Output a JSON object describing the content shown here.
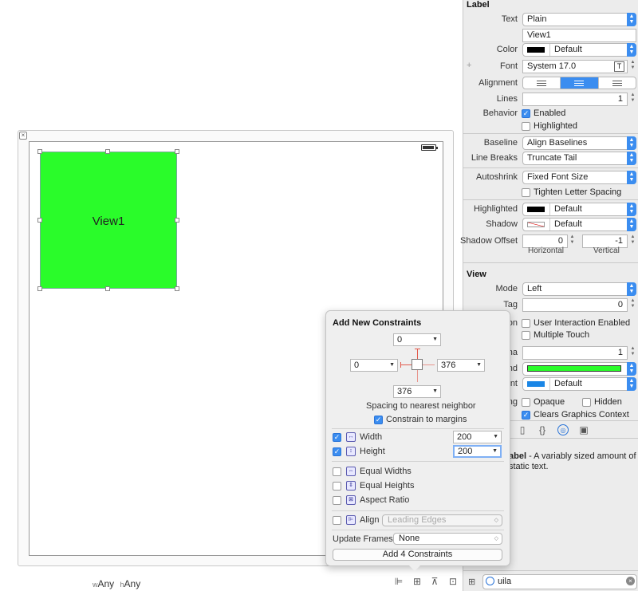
{
  "canvas": {
    "view_label": "View1",
    "size_class": {
      "w_prefix": "w",
      "w_value": "Any",
      "h_prefix": "h",
      "h_value": "Any"
    }
  },
  "inspector": {
    "label_section": {
      "title": "Label",
      "text_label": "Text",
      "text_value": "Plain",
      "text_field": "View1",
      "color_label": "Color",
      "color_value": "Default",
      "font_label": "Font",
      "font_value": "System 17.0",
      "alignment_label": "Alignment",
      "lines_label": "Lines",
      "lines_value": "1",
      "behavior_label": "Behavior",
      "enabled_label": "Enabled",
      "highlighted_check_label": "Highlighted",
      "baseline_label": "Baseline",
      "baseline_value": "Align Baselines",
      "line_breaks_label": "Line Breaks",
      "line_breaks_value": "Truncate Tail",
      "autoshrink_label": "Autoshrink",
      "autoshrink_value": "Fixed Font Size",
      "tighten_label": "Tighten Letter Spacing",
      "highlighted_label": "Highlighted",
      "highlighted_value": "Default",
      "shadow_label": "Shadow",
      "shadow_value": "Default",
      "shadow_offset_label": "Shadow Offset",
      "shadow_h_value": "0",
      "shadow_v_value": "-1",
      "horizontal_caption": "Horizontal",
      "vertical_caption": "Vertical"
    },
    "view_section": {
      "title": "View",
      "mode_label": "Mode",
      "mode_value": "Left",
      "tag_label": "Tag",
      "tag_value": "0",
      "interaction_label_partial": "on",
      "user_interaction_label": "User Interaction Enabled",
      "multiple_touch_label": "Multiple Touch",
      "alpha_label_partial": "ha",
      "alpha_value": "1",
      "background_label_partial": "nd",
      "tint_label_partial": "int",
      "tint_value": "Default",
      "drawing_label_partial": "ng",
      "opaque_label": "Opaque",
      "hidden_label": "Hidden",
      "clears_label": "Clears Graphics Context"
    },
    "library": {
      "desc_bold": "abel",
      "desc_text": " - A variably sized amount of static text."
    },
    "search": {
      "value": "uila"
    }
  },
  "popover": {
    "title": "Add New Constraints",
    "top_value": "0",
    "left_value": "0",
    "right_value": "376",
    "bottom_value": "376",
    "spacing_caption": "Spacing to nearest neighbor",
    "constrain_margins_label": "Constrain to margins",
    "width_label": "Width",
    "width_value": "200",
    "height_label": "Height",
    "height_value": "200",
    "equal_widths_label": "Equal Widths",
    "equal_heights_label": "Equal Heights",
    "aspect_ratio_label": "Aspect Ratio",
    "align_label": "Align",
    "align_value": "Leading Edges",
    "update_frames_label": "Update Frames",
    "update_frames_value": "None",
    "add_button_label": "Add 4 Constraints"
  },
  "colors": {
    "view_green": "#2afc2a",
    "accent_blue": "#3b8df0",
    "strut_red": "#e2594b",
    "tint_blue": "#1a86e6"
  }
}
